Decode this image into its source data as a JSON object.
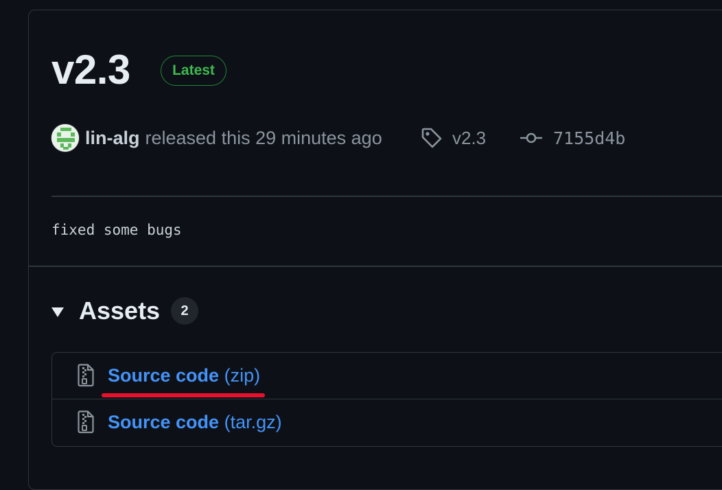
{
  "release": {
    "version": "v2.3",
    "latest_badge": "Latest",
    "author": "lin-alg",
    "released_text": "released this 29 minutes ago",
    "tag": "v2.3",
    "commit": "7155d4b",
    "notes": "fixed some bugs"
  },
  "assets": {
    "title": "Assets",
    "count": "2",
    "items": [
      {
        "name": "Source code",
        "ext": "(zip)"
      },
      {
        "name": "Source code",
        "ext": "(tar.gz)"
      }
    ]
  },
  "icons": {
    "tag": "tag-icon",
    "commit": "git-commit-icon",
    "file": "file-zip-icon",
    "avatar": "user-avatar"
  },
  "colors": {
    "background": "#0d1117",
    "border": "#30363d",
    "link": "#4493f8",
    "latest": "#3fb950",
    "muted": "#8b949e",
    "annotation": "#e8112d"
  }
}
